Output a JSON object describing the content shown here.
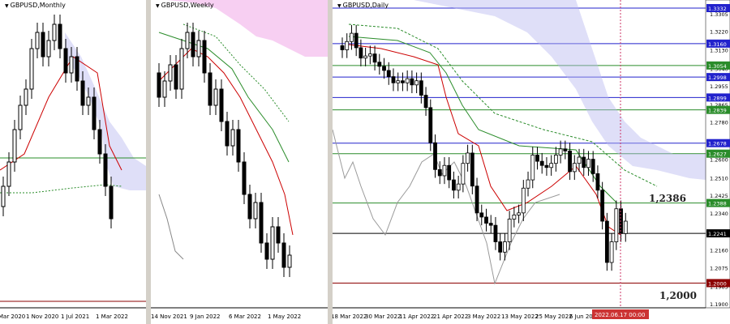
{
  "panels": [
    {
      "id": "monthly",
      "title": "GBPUSD,Monthly",
      "xlabels": [
        "Mar 2020",
        "1 Nov 2020",
        "1 Jul 2021",
        "1 Mar 2022"
      ]
    },
    {
      "id": "weekly",
      "title": "GBPUSD,Weekly",
      "xlabels": [
        "14 Nov 2021",
        "9 Jan 2022",
        "6 Mar 2022",
        "1 May 2022"
      ]
    },
    {
      "id": "daily",
      "title": "GBPUSD,Daily",
      "xlabels": [
        "18 Mar 2022",
        "30 Mar 2022",
        "11 Apr 2022",
        "21 Apr 2022",
        "3 May 2022",
        "13 May 2022",
        "25 May 2022",
        "6 Jun 2022"
      ]
    }
  ],
  "daily_axis": {
    "ticks": [
      "1.3305",
      "1.3220",
      "1.3130",
      "1.3040",
      "1.2955",
      "1.2865",
      "1.2780",
      "1.2690",
      "1.2600",
      "1.2510",
      "1.2425",
      "1.2340",
      "1.2250",
      "1.2160",
      "1.2075",
      "1.1985",
      "1.1900"
    ],
    "levels": [
      {
        "value": "1.3332",
        "color": "#2222cc"
      },
      {
        "value": "1.3160",
        "color": "#2222cc"
      },
      {
        "value": "1.3054",
        "color": "#2a8c2a"
      },
      {
        "value": "1.2998",
        "color": "#2222cc"
      },
      {
        "value": "1.2899",
        "color": "#2222cc"
      },
      {
        "value": "1.2839",
        "color": "#2a8c2a"
      },
      {
        "value": "1.2678",
        "color": "#2222cc"
      },
      {
        "value": "1.2627",
        "color": "#2a8c2a"
      },
      {
        "value": "1.2388",
        "color": "#2a8c2a"
      },
      {
        "value": "1.2241",
        "color": "#000000"
      },
      {
        "value": "1.2000",
        "color": "#8b0000"
      }
    ],
    "date_marker": "2022.06.17 00:00"
  },
  "annotations": {
    "upper": "1,2386",
    "lower": "1,2000"
  },
  "chart_data": [
    {
      "type": "candlestick",
      "symbol": "GBPUSD",
      "timeframe": "Monthly",
      "x": [
        "Mar 2020",
        "1 Nov 2020",
        "1 Jul 2021",
        "1 Mar 2022"
      ]
    },
    {
      "type": "candlestick",
      "symbol": "GBPUSD",
      "timeframe": "Weekly",
      "x": [
        "14 Nov 2021",
        "9 Jan 2022",
        "6 Mar 2022",
        "1 May 2022"
      ]
    },
    {
      "type": "candlestick",
      "symbol": "GBPUSD",
      "timeframe": "Daily",
      "x": [
        "18 Mar 2022",
        "30 Mar 2022",
        "11 Apr 2022",
        "21 Apr 2022",
        "3 May 2022",
        "13 May 2022",
        "25 May 2022",
        "6 Jun 2022"
      ],
      "ylim": [
        1.19,
        1.334
      ],
      "series": [
        {
          "values": [
            1.313,
            1.317,
            1.321,
            1.314,
            1.309,
            1.31,
            1.311,
            1.307,
            1.305,
            1.303,
            1.3,
            1.297,
            1.298,
            1.297,
            1.299,
            1.296,
            1.298,
            1.291,
            1.285,
            1.268,
            1.255,
            1.252,
            1.257,
            1.25,
            1.245,
            1.248,
            1.258,
            1.263,
            1.247,
            1.234,
            1.232,
            1.229,
            1.228,
            1.22,
            1.215,
            1.22,
            1.231,
            1.233,
            1.234,
            1.246,
            1.25,
            1.262,
            1.259,
            1.257,
            1.256,
            1.258,
            1.262,
            1.265,
            1.264,
            1.254,
            1.258,
            1.261,
            1.256,
            1.26,
            1.253,
            1.245,
            1.23,
            1.21,
            1.22,
            1.236,
            1.224,
            1.23
          ]
        }
      ]
    }
  ]
}
